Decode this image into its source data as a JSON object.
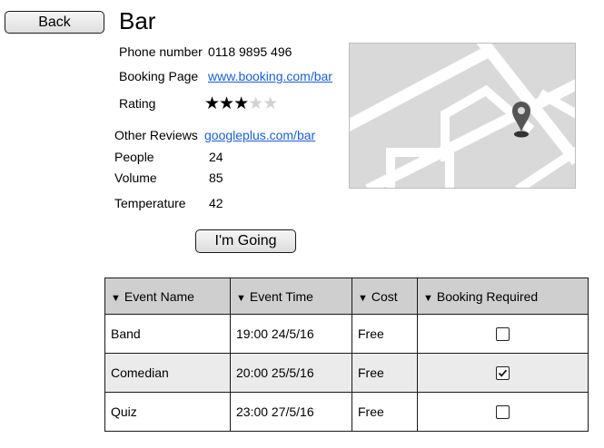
{
  "header": {
    "back_label": "Back",
    "title": "Bar"
  },
  "details": {
    "phone_label": "Phone number",
    "phone_value": "0118 9895 496",
    "booking_label": "Booking Page",
    "booking_link": "www.booking.com/bar",
    "rating_label": "Rating",
    "rating": {
      "value": 3,
      "max": 5
    },
    "other_reviews_label": "Other Reviews",
    "other_reviews_link": "googleplus.com/bar",
    "people_label": "People",
    "people_value": "24",
    "volume_label": "Volume",
    "volume_value": "85",
    "temperature_label": "Temperature",
    "temperature_value": "42"
  },
  "going_label": "I'm Going",
  "map": {
    "icon": "map-pin-icon",
    "background_color": "#d9d9d9",
    "road_color": "#ffffff",
    "pin_color": "#555555"
  },
  "events": {
    "columns": [
      "Event Name",
      "Event Time",
      "Cost",
      "Booking Required"
    ],
    "rows": [
      {
        "name": "Band",
        "time": "19:00 24/5/16",
        "cost": "Free",
        "booking_required": false
      },
      {
        "name": "Comedian",
        "time": "20:00 25/5/16",
        "cost": "Free",
        "booking_required": true
      },
      {
        "name": "Quiz",
        "time": "23:00 27/5/16",
        "cost": "Free",
        "booking_required": false
      }
    ]
  }
}
